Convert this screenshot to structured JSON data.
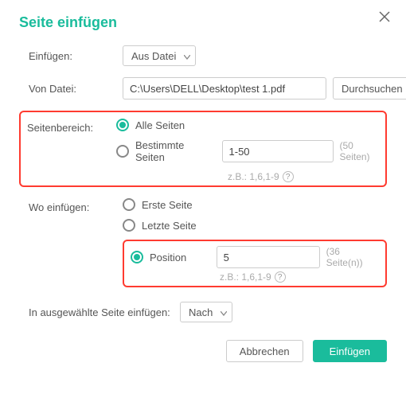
{
  "title": "Seite einfügen",
  "close_icon": "close",
  "insert": {
    "label": "Einfügen:",
    "source": "Aus Datei"
  },
  "fromFile": {
    "label": "Von Datei:",
    "path": "C:\\Users\\DELL\\Desktop\\test 1.pdf",
    "browse": "Durchsuchen"
  },
  "range": {
    "label": "Seitenbereich:",
    "all": "Alle Seiten",
    "some": "Bestimmte Seiten",
    "value": "1-50",
    "count": "(50 Seiten)",
    "hint": "z.B.: 1,6,1-9"
  },
  "where": {
    "label": "Wo einfügen:",
    "first": "Erste Seite",
    "last": "Letzte Seite",
    "position": "Position",
    "value": "5",
    "count": "(36 Seite(n))",
    "hint": "z.B.: 1,6,1-9"
  },
  "relative": {
    "label": "In ausgewählte Seite einfügen:",
    "value": "Nach"
  },
  "actions": {
    "cancel": "Abbrechen",
    "ok": "Einfügen"
  }
}
